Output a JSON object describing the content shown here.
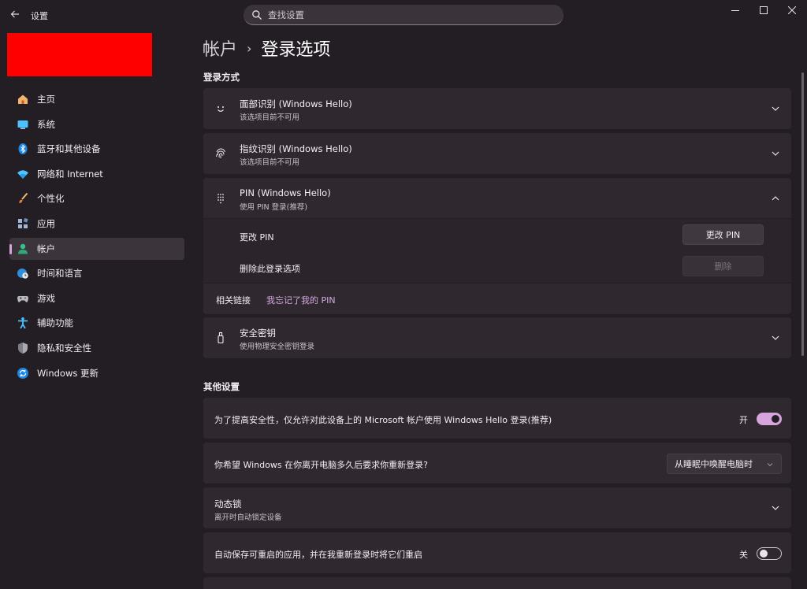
{
  "window": {
    "title": "设置",
    "minimize_icon": "minimize-icon",
    "maximize_icon": "maximize-icon",
    "close_icon": "close-icon"
  },
  "search": {
    "placeholder": "查找设置"
  },
  "sidebar": {
    "items": [
      {
        "label": "主页",
        "icon": "home-icon"
      },
      {
        "label": "系统",
        "icon": "monitor-icon"
      },
      {
        "label": "蓝牙和其他设备",
        "icon": "bluetooth-icon"
      },
      {
        "label": "网络和 Internet",
        "icon": "wifi-icon"
      },
      {
        "label": "个性化",
        "icon": "brush-icon"
      },
      {
        "label": "应用",
        "icon": "apps-icon"
      },
      {
        "label": "帐户",
        "icon": "account-icon",
        "active": true
      },
      {
        "label": "时间和语言",
        "icon": "globe-clock-icon"
      },
      {
        "label": "游戏",
        "icon": "gamepad-icon"
      },
      {
        "label": "辅助功能",
        "icon": "accessibility-icon"
      },
      {
        "label": "隐私和安全性",
        "icon": "shield-icon"
      },
      {
        "label": "Windows 更新",
        "icon": "update-icon"
      }
    ]
  },
  "breadcrumb": {
    "parent": "帐户",
    "separator": "›",
    "current": "登录选项"
  },
  "signin": {
    "section_title": "登录方式",
    "face": {
      "title": "面部识别 (Windows Hello)",
      "subtitle": "该选项目前不可用"
    },
    "fingerprint": {
      "title": "指纹识别 (Windows Hello)",
      "subtitle": "该选项目前不可用"
    },
    "pin": {
      "title": "PIN (Windows Hello)",
      "subtitle": "使用 PIN 登录(推荐)",
      "change_label": "更改 PIN",
      "change_button": "更改 PIN",
      "remove_label": "删除此登录选项",
      "remove_button": "删除",
      "related_label": "相关链接",
      "forgot_link": "我忘记了我的 PIN"
    },
    "security_key": {
      "title": "安全密钥",
      "subtitle": "使用物理安全密钥登录"
    }
  },
  "other": {
    "section_title": "其他设置",
    "hello_only": {
      "label": "为了提高安全性，仅允许对此设备上的 Microsoft 帐户使用 Windows Hello 登录(推荐)",
      "state_label": "开",
      "on": true
    },
    "require_signin": {
      "label": "你希望 Windows 在你离开电脑多久后要求你重新登录?",
      "value": "从睡眠中唤醒电脑时"
    },
    "dynamic_lock": {
      "title": "动态锁",
      "subtitle": "离开时自动锁定设备"
    },
    "restart_apps": {
      "label": "自动保存可重启的应用，并在我重新登录时将它们重启",
      "state_label": "关",
      "on": false
    }
  },
  "colors": {
    "accent": "#d7a4de",
    "background": "#231e24",
    "card": "#2f292f",
    "redacted": "#ff0000"
  }
}
